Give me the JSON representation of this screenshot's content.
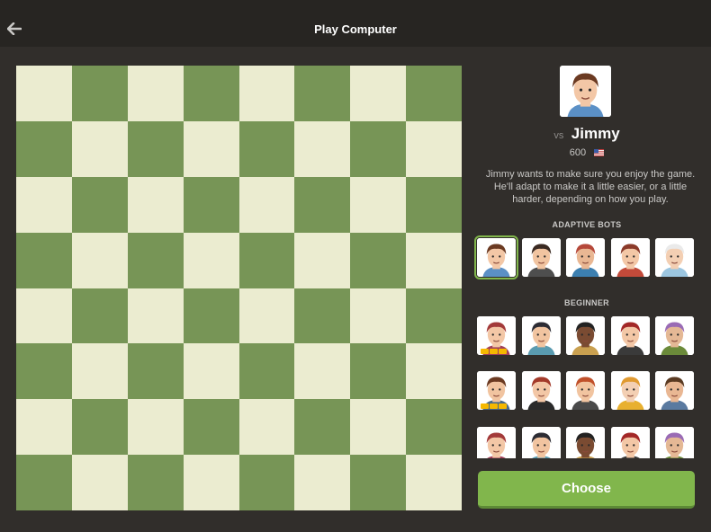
{
  "header": {
    "title": "Play Computer",
    "back_icon": "arrow-left-icon"
  },
  "selected_bot": {
    "vs_label": "vs",
    "name": "Jimmy",
    "rating": "600",
    "flag": "us-flag-icon",
    "description": "Jimmy wants to make sure you enjoy the game. He'll adapt to make it a little easier, or a little harder, depending on how you play."
  },
  "sections": {
    "adaptive_label": "ADAPTIVE BOTS",
    "beginner_label": "BEGINNER"
  },
  "adaptive_bots": [
    {
      "hair": "#6b3a22",
      "skin": "#f3c7a6",
      "shirt": "#5b90c6",
      "selected": true
    },
    {
      "hair": "#3a2a22",
      "skin": "#f1c4a0",
      "shirt": "#4e4e4e",
      "selected": false
    },
    {
      "hair": "#b5483a",
      "skin": "#e9b793",
      "shirt": "#3c7fb0",
      "selected": false
    },
    {
      "hair": "#8b3a2a",
      "skin": "#f3c7a6",
      "shirt": "#c24a3a",
      "selected": false
    },
    {
      "hair": "#eaeaea",
      "skin": "#f3cfb3",
      "shirt": "#9cc6e0",
      "selected": false
    }
  ],
  "beginner_bots": [
    {
      "hair": "#a33a3a",
      "skin": "#f3c7a6",
      "shirt": "#a2405a",
      "crowns": 3
    },
    {
      "hair": "#2c2c34",
      "skin": "#f1c4a0",
      "shirt": "#5a9bb0",
      "crowns": 0
    },
    {
      "hair": "#222222",
      "skin": "#7a4b32",
      "shirt": "#c9a050",
      "crowns": 0
    },
    {
      "hair": "#a32828",
      "skin": "#f3c7a6",
      "shirt": "#3a3a3a",
      "crowns": 0
    },
    {
      "hair": "#9a6bb5",
      "skin": "#e4b895",
      "shirt": "#6b8a3a",
      "crowns": 0
    },
    {
      "hair": "#6b3a22",
      "skin": "#f1c4a0",
      "shirt": "#4a6a8a",
      "crowns": 3
    },
    {
      "hair": "#a33a2a",
      "skin": "#f3c7a6",
      "shirt": "#2a2a2a",
      "crowns": 0
    },
    {
      "hair": "#c0502a",
      "skin": "#f1c4a0",
      "shirt": "#4a4a4a",
      "crowns": 0
    },
    {
      "hair": "#e09a30",
      "skin": "#f3cfb3",
      "shirt": "#e8b030",
      "crowns": 0
    },
    {
      "hair": "#5a3a22",
      "skin": "#e9b793",
      "shirt": "#5a7aa0",
      "crowns": 0
    },
    {
      "hair": "#a33a3a",
      "skin": "#f3c7a6",
      "shirt": "#a2405a",
      "crowns": 0
    },
    {
      "hair": "#2c2c34",
      "skin": "#f1c4a0",
      "shirt": "#5a9bb0",
      "crowns": 0
    },
    {
      "hair": "#222222",
      "skin": "#7a4b32",
      "shirt": "#c9a050",
      "crowns": 0
    },
    {
      "hair": "#a32828",
      "skin": "#f3c7a6",
      "shirt": "#3a3a3a",
      "crowns": 0
    },
    {
      "hair": "#9a6bb5",
      "skin": "#e4b895",
      "shirt": "#6b8a3a",
      "crowns": 0
    }
  ],
  "choose_button": "Choose",
  "colors": {
    "light_square": "#ebecd0",
    "dark_square": "#779556",
    "accent": "#81b64c"
  }
}
